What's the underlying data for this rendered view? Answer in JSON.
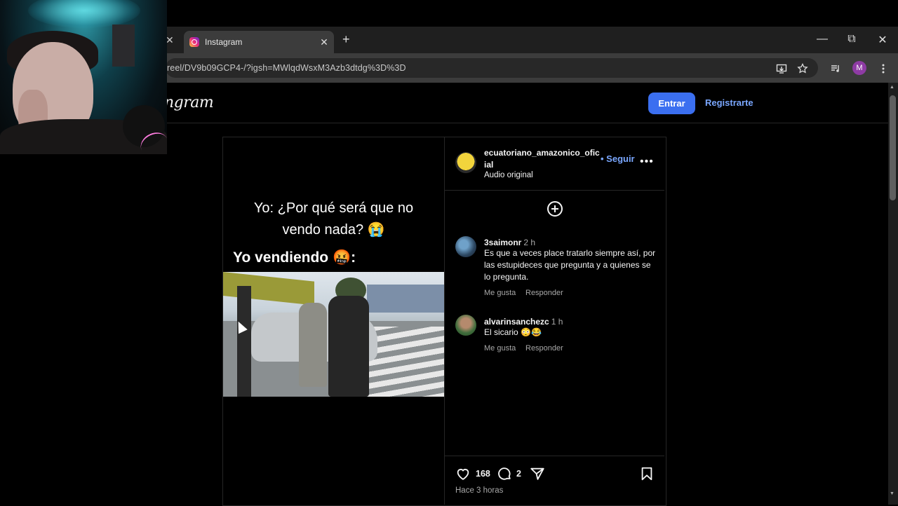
{
  "browser": {
    "tab_title": "Instagram",
    "tab_close": "✕",
    "prev_tab_close": "✕",
    "new_tab": "+",
    "url": "reel/DV9b09GCP4-/?igsh=MWlqdWsxM3Azb3dtdg%3D%3D",
    "window_controls": {
      "minimize": "—",
      "restore": "⧉",
      "close": "✕"
    },
    "profile_initial": "M"
  },
  "instagram": {
    "logo": "ngram",
    "login_button": "Entrar",
    "signup_link": "Registrarte"
  },
  "post": {
    "caption_line1": "Yo: ¿Por qué será que no",
    "caption_line2": "vendo nada? 😭",
    "caption_line3": "Yo vendiendo 🤬:",
    "account_name": "ecuatoriano_amazonico_oficial",
    "follow": "• Seguir",
    "more": "•••",
    "audio": "Audio original",
    "likes": "168",
    "comments_count": "2",
    "time_ago": "Hace 3 horas"
  },
  "comments": [
    {
      "user": "3saimonr",
      "time": "2 h",
      "text": "Es que a veces place tratarlo siempre así, por las estupideces que pregunta y a quienes se lo pregunta.",
      "like": "Me gusta",
      "reply": "Responder"
    },
    {
      "user": "alvarinsanchezc",
      "time": "1 h",
      "text": "El sicario 😳😂",
      "like": "Me gusta",
      "reply": "Responder"
    }
  ]
}
